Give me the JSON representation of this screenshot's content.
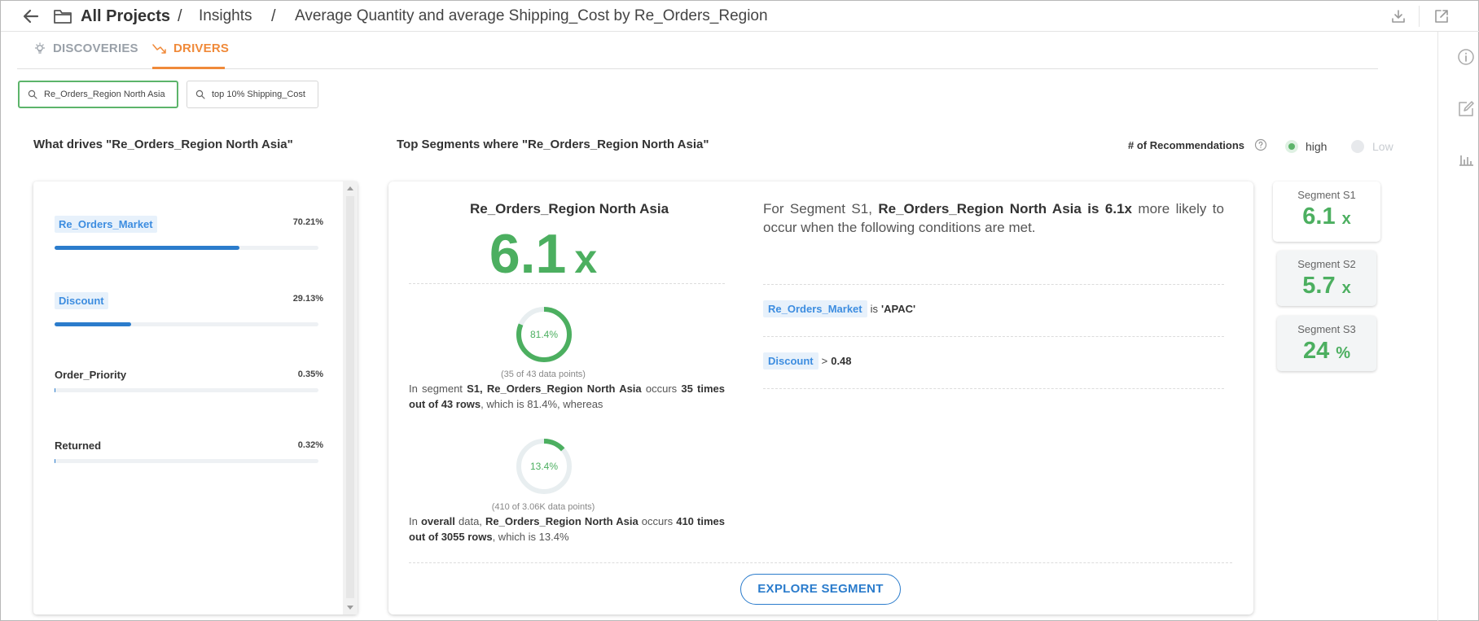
{
  "header": {
    "root": "All Projects",
    "crumbs": [
      "Insights",
      "Average Quantity and average Shipping_Cost by Re_Orders_Region"
    ],
    "sep": "/"
  },
  "tabs": [
    {
      "label": "DISCOVERIES",
      "icon": "bulb-icon",
      "active": false
    },
    {
      "label": "DRIVERS",
      "icon": "trend-icon",
      "active": true
    }
  ],
  "filters": [
    "Re_Orders_Region North Asia",
    "top 10% Shipping_Cost"
  ],
  "left_title": "What drives \"Re_Orders_Region North Asia\"",
  "right_title": "Top Segments where \"Re_Orders_Region North Asia\"",
  "recommendations": {
    "label": "# of Recommendations",
    "high": "high",
    "low": "Low",
    "selected": "high"
  },
  "drivers": [
    {
      "name": "Re_Orders_Market",
      "pct": "70.21%",
      "value": 70.21,
      "highlight": true
    },
    {
      "name": "Discount",
      "pct": "29.13%",
      "value": 29.13,
      "highlight": true
    },
    {
      "name": "Order_Priority",
      "pct": "0.35%",
      "value": 0.35,
      "highlight": false
    },
    {
      "name": "Returned",
      "pct": "0.32%",
      "value": 0.32,
      "highlight": false
    }
  ],
  "segment": {
    "title": "Re_Orders_Region North Asia",
    "big_value": "6.1",
    "big_unit": "x",
    "seg_donut": {
      "label": "81.4%",
      "value": 81.4,
      "sub": "(35 of 43 data points)"
    },
    "overall_donut": {
      "label": "13.4%",
      "value": 13.4,
      "sub": "(410 of 3.06K data points)"
    },
    "seg_text": {
      "p1": "In segment ",
      "b1": "S1, Re_Orders_Region North Asia",
      "p2": " occurs ",
      "b2": "35 times out of 43 rows",
      "p3": ", which is 81.4%, whereas"
    },
    "overall_text": {
      "p1": "In ",
      "b1": "overall",
      "p2": " data, ",
      "b2": "Re_Orders_Region North Asia",
      "p3": " occurs ",
      "b3": "410 times out of 3055 rows",
      "p4": ", which is 13.4%"
    },
    "explain": {
      "p1": "For Segment S1, ",
      "b1": "Re_Orders_Region North Asia is 6.1x",
      "p2": " more likely to occur when the following conditions are met."
    },
    "conditions": [
      {
        "field": "Re_Orders_Market",
        "op": "is",
        "value": "'APAC'"
      },
      {
        "field": "Discount",
        "op": ">",
        "value": "0.48"
      }
    ],
    "explore_label": "EXPLORE SEGMENT"
  },
  "segments": [
    {
      "label": "Segment S1",
      "value": "6.1",
      "unit": "x",
      "active": true
    },
    {
      "label": "Segment S2",
      "value": "5.7",
      "unit": "x",
      "active": false
    },
    {
      "label": "Segment S3",
      "value": "24",
      "unit": "%",
      "active": false
    }
  ],
  "colors": {
    "accent_orange": "#f08a3a",
    "green": "#4caf60",
    "blue": "#2b7ccc"
  }
}
